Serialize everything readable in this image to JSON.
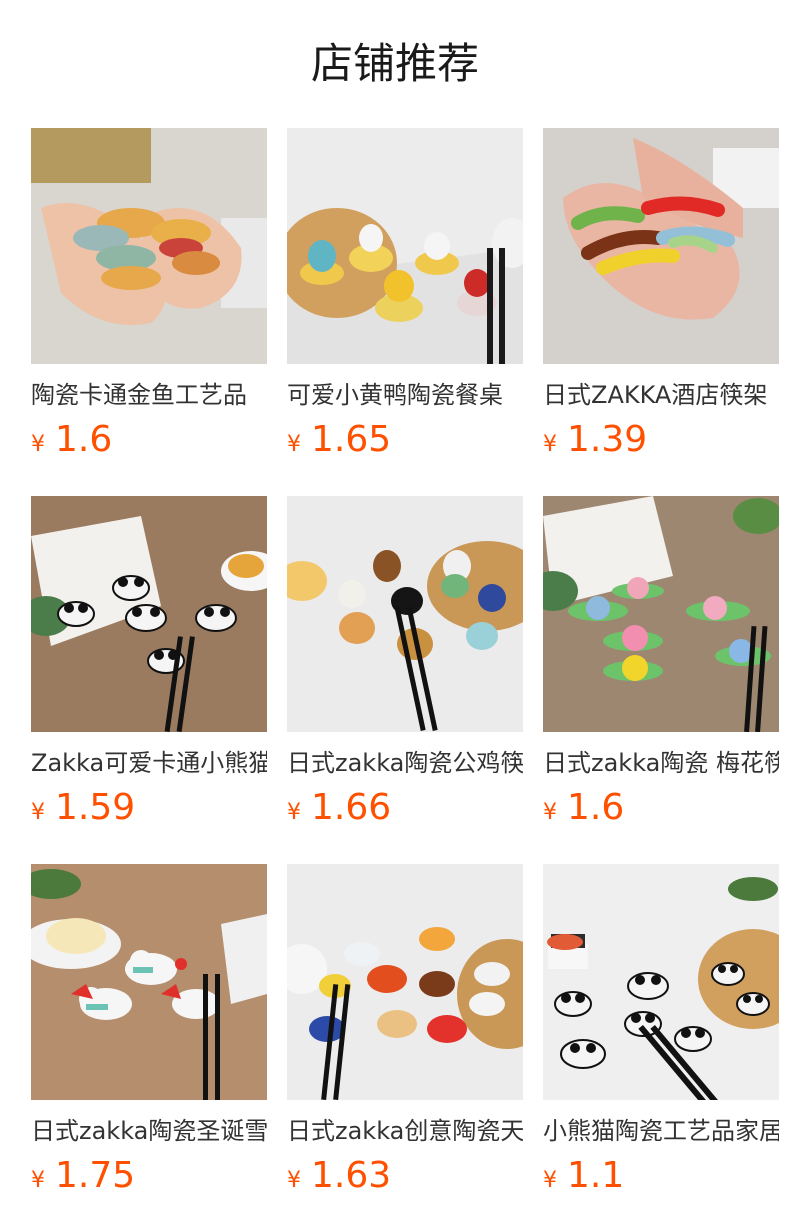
{
  "page": {
    "title": "店铺推荐"
  },
  "products": [
    {
      "name": "陶瓷卡通金鱼工艺品",
      "currency": "¥",
      "price": "1.6",
      "theme": "goldfish"
    },
    {
      "name": "可爱小黄鸭陶瓷餐桌",
      "currency": "¥",
      "price": "1.65",
      "theme": "duck"
    },
    {
      "name": "日式ZAKKA酒店筷架",
      "currency": "¥",
      "price": "1.39",
      "theme": "rests"
    },
    {
      "name": "Zakka可爱卡通小熊猫",
      "currency": "¥",
      "price": "1.59",
      "theme": "panda-wood"
    },
    {
      "name": "日式zakka陶瓷公鸡筷",
      "currency": "¥",
      "price": "1.66",
      "theme": "rooster"
    },
    {
      "name": "日式zakka陶瓷 梅花筷",
      "currency": "¥",
      "price": "1.6",
      "theme": "flower"
    },
    {
      "name": "日式zakka陶瓷圣诞雪人",
      "currency": "¥",
      "price": "1.75",
      "theme": "snowman"
    },
    {
      "name": "日式zakka创意陶瓷天鹅",
      "currency": "¥",
      "price": "1.63",
      "theme": "swan"
    },
    {
      "name": "小熊猫陶瓷工艺品家居",
      "currency": "¥",
      "price": "1.1",
      "theme": "panda-white"
    }
  ],
  "colors": {
    "price": "#ff5000",
    "title": "#1a1a1a",
    "text": "#333333"
  }
}
